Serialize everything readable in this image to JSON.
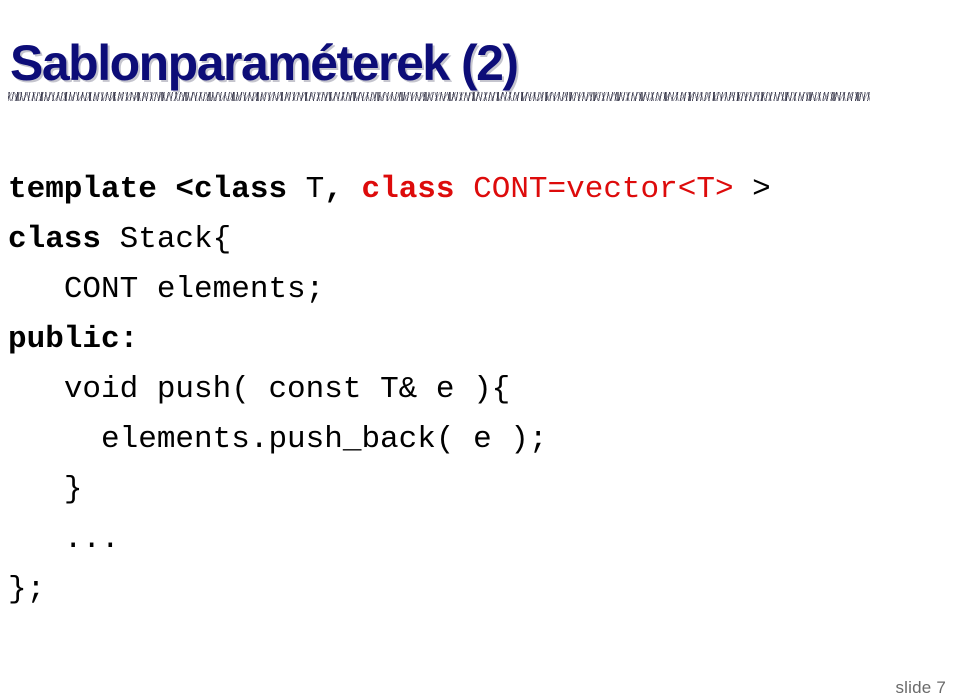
{
  "slide": {
    "title": "Sablonparaméterek (2)",
    "title_color": "#0d0d78",
    "background_color": "#ffffff",
    "accent_color": "#dd0b0b",
    "body_color": "#000000",
    "slide_number_label": "slide 7",
    "slide_number_color": "#6a6a6a"
  },
  "code": {
    "language": "cpp",
    "lines": [
      {
        "indent": 0,
        "tokens": [
          {
            "text": "template <class ",
            "bold": true,
            "color": "#000000"
          },
          {
            "text": "T",
            "bold": false,
            "color": "#000000"
          },
          {
            "text": ", ",
            "bold": true,
            "color": "#000000"
          },
          {
            "text": "class ",
            "bold": true,
            "color": "#dd0b0b"
          },
          {
            "text": "CONT=vector<T>",
            "bold": false,
            "color": "#dd0b0b"
          },
          {
            "text": " >",
            "bold": false,
            "color": "#000000"
          }
        ]
      },
      {
        "indent": 0,
        "tokens": [
          {
            "text": "class ",
            "bold": true,
            "color": "#000000"
          },
          {
            "text": "Stack{",
            "bold": false,
            "color": "#000000"
          }
        ]
      },
      {
        "indent": 3,
        "tokens": [
          {
            "text": "CONT elements;",
            "bold": false,
            "color": "#000000"
          }
        ]
      },
      {
        "indent": 0,
        "tokens": [
          {
            "text": "public:",
            "bold": true,
            "color": "#000000"
          }
        ]
      },
      {
        "indent": 3,
        "tokens": [
          {
            "text": "void push( const T& e ){",
            "bold": false,
            "color": "#000000"
          }
        ]
      },
      {
        "indent": 5,
        "tokens": [
          {
            "text": "elements.push_back( e );",
            "bold": false,
            "color": "#000000"
          }
        ]
      },
      {
        "indent": 3,
        "tokens": [
          {
            "text": "}",
            "bold": false,
            "color": "#000000"
          }
        ]
      },
      {
        "indent": 3,
        "tokens": [
          {
            "text": "...",
            "bold": false,
            "color": "#000000"
          }
        ]
      },
      {
        "indent": 0,
        "tokens": [
          {
            "text": "};",
            "bold": false,
            "color": "#000000"
          }
        ]
      }
    ]
  }
}
